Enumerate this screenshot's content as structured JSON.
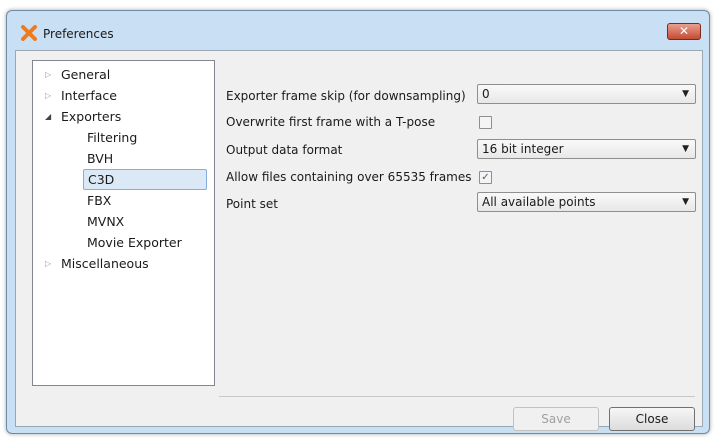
{
  "window": {
    "title": "Preferences",
    "close_glyph": "✕",
    "app_icon": "x-logo-icon",
    "accent_color": "#f07a1e"
  },
  "tree": {
    "items": [
      {
        "label": "General",
        "expanded": false,
        "has_children": true
      },
      {
        "label": "Interface",
        "expanded": false,
        "has_children": true
      },
      {
        "label": "Exporters",
        "expanded": true,
        "has_children": true
      },
      {
        "label": "Filtering"
      },
      {
        "label": "BVH"
      },
      {
        "label": "C3D",
        "selected": true
      },
      {
        "label": "FBX"
      },
      {
        "label": "MVNX"
      },
      {
        "label": "Movie Exporter"
      },
      {
        "label": "Miscellaneous",
        "expanded": false,
        "has_children": true
      }
    ],
    "collapsed_glyph": "▷",
    "expanded_glyph": "◢"
  },
  "settings": {
    "frame_skip": {
      "label": "Exporter frame skip (for downsampling)",
      "value": "0"
    },
    "overwrite_first": {
      "label": "Overwrite first frame with a T-pose",
      "checked": false
    },
    "output_format": {
      "label": "Output data format",
      "value": "16 bit integer"
    },
    "allow_large": {
      "label": "Allow files containing over 65535 frames",
      "checked": true,
      "check_glyph": "✓"
    },
    "point_set": {
      "label": "Point set",
      "value": "All available points"
    },
    "caret_glyph": "▼"
  },
  "buttons": {
    "save": {
      "label": "Save",
      "enabled": false
    },
    "close": {
      "label": "Close",
      "enabled": true
    }
  }
}
